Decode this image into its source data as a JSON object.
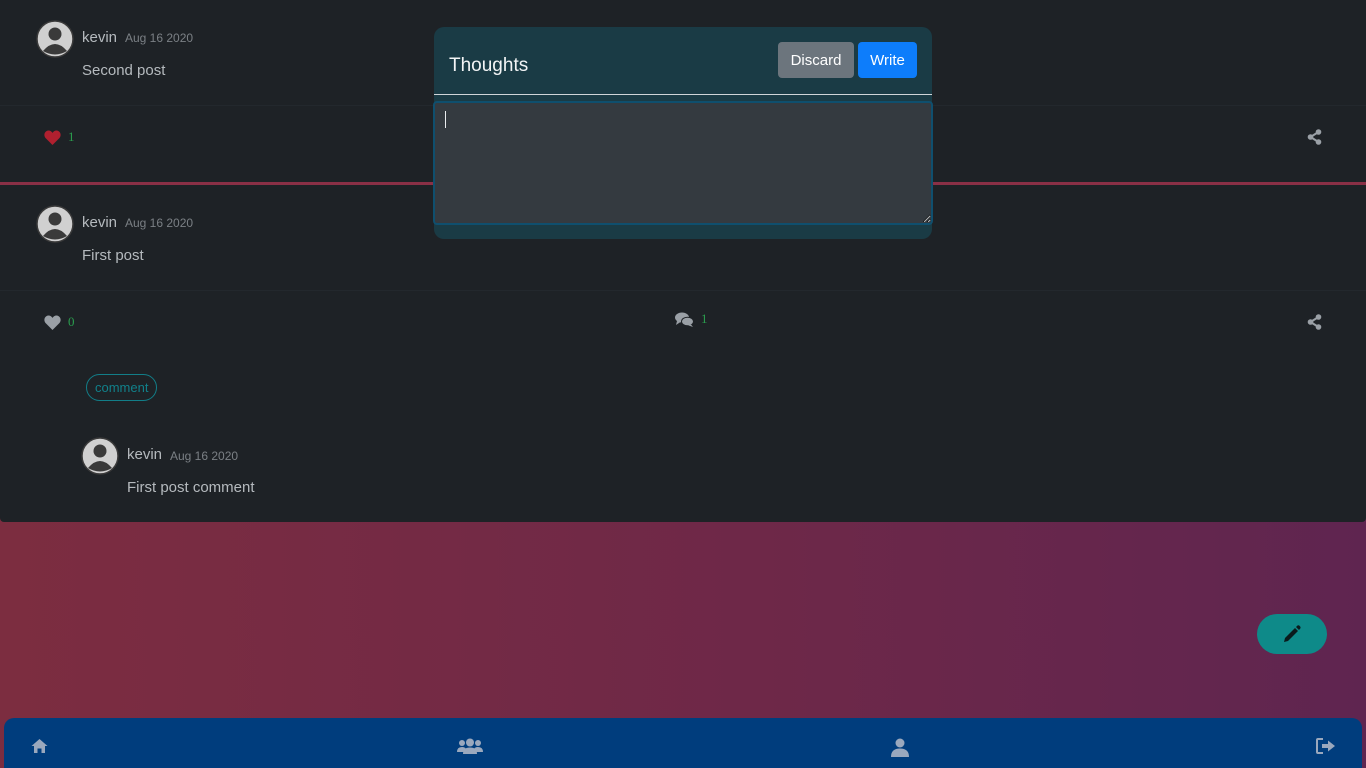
{
  "colors": {
    "card_bg": "#1e2226",
    "modal_bg": "#1a3b45",
    "accent_teal": "#0e8a89",
    "nav_bg": "#003d7d",
    "like_active": "#b0202f",
    "count_green": "#2a9d4e",
    "write_button": "#0d7dfb",
    "discard_button": "#6c757d"
  },
  "posts": [
    {
      "author": "kevin",
      "date": "Aug 16 2020",
      "text": "Second post",
      "likes": "1",
      "liked": true
    },
    {
      "author": "kevin",
      "date": "Aug 16 2020",
      "text": "First post",
      "likes": "0",
      "liked": false,
      "comments_count": "1",
      "comment_button_label": "comment",
      "comments": [
        {
          "author": "kevin",
          "date": "Aug 16 2020",
          "text": "First post comment"
        }
      ]
    }
  ],
  "modal": {
    "title": "Thoughts",
    "discard_label": "Discard",
    "write_label": "Write",
    "input_value": ""
  },
  "icons": {
    "like": "heart-icon",
    "comments": "comments-icon",
    "share": "share-icon",
    "fab": "pencil-icon",
    "nav": [
      "home-icon",
      "users-icon",
      "user-icon",
      "sign-out-icon"
    ]
  }
}
